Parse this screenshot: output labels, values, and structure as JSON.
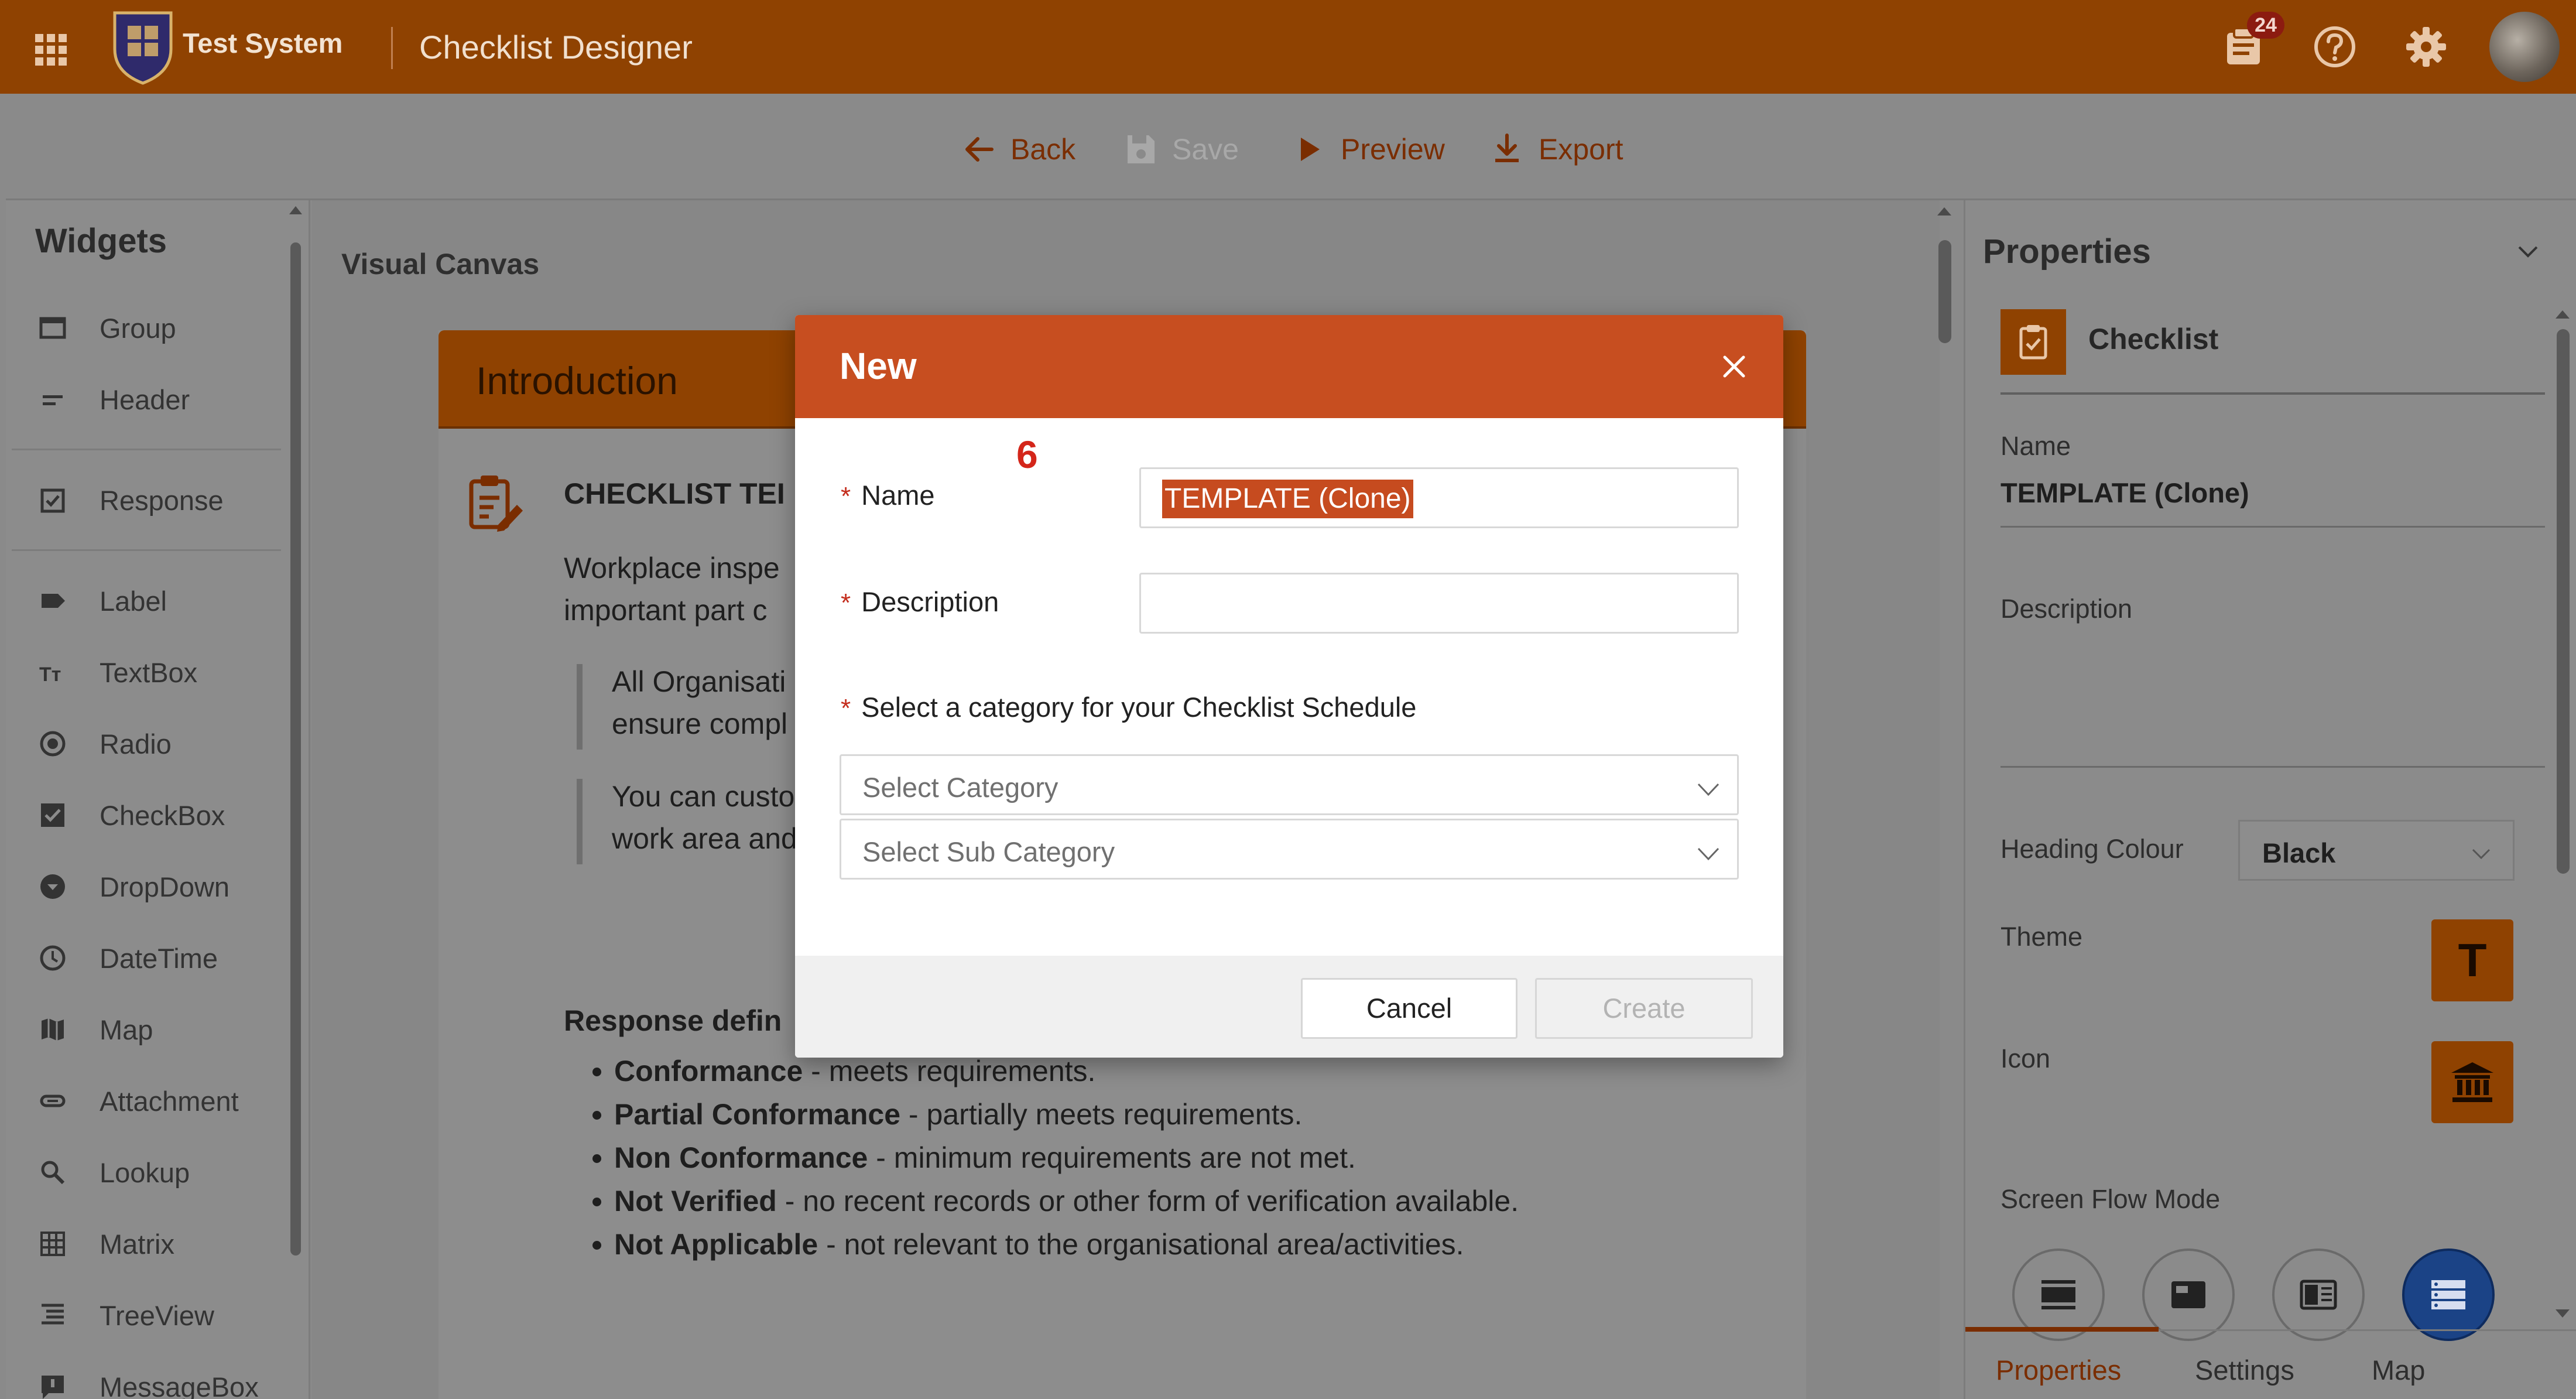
{
  "header": {
    "app_name": "Test System",
    "page_name": "Checklist Designer",
    "notification_count": "24",
    "accent_color": "#c74e20"
  },
  "toolbar": {
    "back_label": "Back",
    "save_label": "Save",
    "preview_label": "Preview",
    "export_label": "Export"
  },
  "widgets": {
    "title": "Widgets",
    "items": [
      {
        "label": "Group",
        "icon": "group-icon"
      },
      {
        "label": "Header",
        "icon": "header-icon"
      },
      {
        "label": "Response",
        "icon": "response-icon"
      },
      {
        "label": "Label",
        "icon": "label-icon"
      },
      {
        "label": "TextBox",
        "icon": "textbox-icon"
      },
      {
        "label": "Radio",
        "icon": "radio-icon"
      },
      {
        "label": "CheckBox",
        "icon": "checkbox-icon"
      },
      {
        "label": "DropDown",
        "icon": "dropdown-icon"
      },
      {
        "label": "DateTime",
        "icon": "clock-icon"
      },
      {
        "label": "Map",
        "icon": "map-icon"
      },
      {
        "label": "Attachment",
        "icon": "attachment-icon"
      },
      {
        "label": "Lookup",
        "icon": "search-icon"
      },
      {
        "label": "Matrix",
        "icon": "matrix-icon"
      },
      {
        "label": "TreeView",
        "icon": "treeview-icon"
      },
      {
        "label": "MessageBox",
        "icon": "messagebox-icon"
      }
    ]
  },
  "canvas": {
    "title": "Visual Canvas",
    "card_title": "Introduction",
    "heading": "CHECKLIST TEI",
    "para_1": "Workplace inspe",
    "para_2": "important part c",
    "quote_1a": "All Organisati",
    "quote_1b": "ensure compl",
    "quote_2a": "You can custo",
    "quote_2b": "work area and",
    "response_title": "Response defin",
    "definitions": [
      {
        "term": "Conformance",
        "desc": " - meets requirements."
      },
      {
        "term": "Partial Conformance",
        "desc": " - partially meets requirements."
      },
      {
        "term": "Non Conformance",
        "desc": " - minimum requirements are not met."
      },
      {
        "term": "Not Verified",
        "desc": " - no recent records or other form of verification available."
      },
      {
        "term": "Not Applicable",
        "desc": " - not relevant to the organisational area/activities."
      }
    ]
  },
  "properties": {
    "title": "Properties",
    "item_title": "Checklist",
    "name_label": "Name",
    "name_value": "TEMPLATE (Clone)",
    "description_label": "Description",
    "heading_colour_label": "Heading Colour",
    "heading_colour_value": "Black",
    "theme_label": "Theme",
    "theme_glyph": "T",
    "icon_label": "Icon",
    "screen_flow_label": "Screen Flow Mode",
    "tabs": [
      "Properties",
      "Settings",
      "Map"
    ]
  },
  "modal": {
    "title": "New",
    "step_marker": "6",
    "name_label": "Name",
    "name_value": "TEMPLATE (Clone)",
    "description_label": "Description",
    "category_prompt": "Select a category for your Checklist Schedule",
    "category_placeholder": "Select Category",
    "subcategory_placeholder": "Select Sub Category",
    "cancel_label": "Cancel",
    "create_label": "Create"
  }
}
